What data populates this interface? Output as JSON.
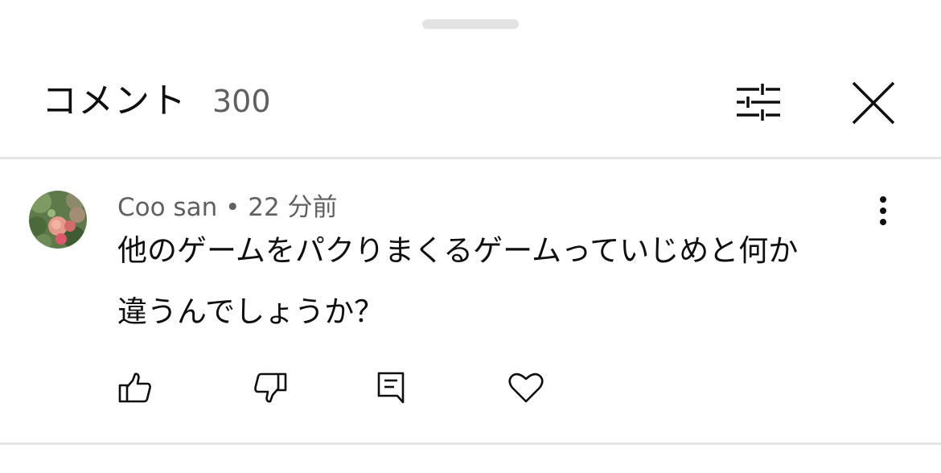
{
  "header": {
    "title": "コメント",
    "count": "300"
  },
  "comment": {
    "author": "Coo san",
    "separator": "•",
    "time": "22 分前",
    "lines": [
      "他のゲームをパクりまくるゲームっていじめと何か",
      "違うんでしょうか？"
    ]
  },
  "icons": {
    "filter": "sliders-icon",
    "close": "close-icon",
    "more": "more-vertical-icon",
    "like": "thumbs-up-icon",
    "dislike": "thumbs-down-icon",
    "reply": "reply-comment-icon",
    "heart": "heart-icon"
  },
  "colors": {
    "primary_text": "#0f0f0f",
    "secondary_text": "#606060",
    "divider": "#e5e5e5",
    "handle": "#e3e3e3"
  }
}
